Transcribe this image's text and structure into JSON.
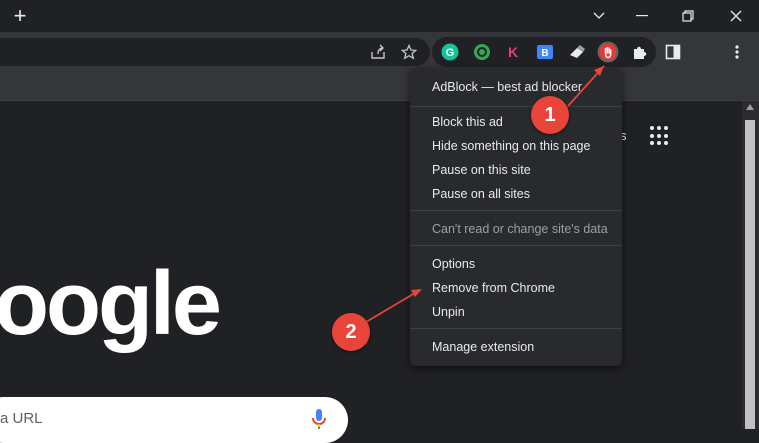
{
  "titlebar": {
    "new_tab_glyph": "+",
    "icons": [
      "chevron-down-icon",
      "restore-icon",
      "close-icon"
    ]
  },
  "toolbar": {
    "icons": [
      "share-icon",
      "star-icon",
      "puzzle-icon",
      "sidepanel-icon",
      "kebab-menu-icon"
    ]
  },
  "extensions": [
    {
      "name": "grammarly-icon",
      "glyph": "G",
      "color": "#15c39a"
    },
    {
      "name": "green-extension-icon",
      "glyph": "",
      "color": "#34a853"
    },
    {
      "name": "k-extension-icon",
      "glyph": "K",
      "color": "#e2436b"
    },
    {
      "name": "blue-extension-icon",
      "glyph": "B",
      "color": "#4285f4"
    },
    {
      "name": "eraser-extension-icon",
      "glyph": "",
      "color": "#e8eaed"
    },
    {
      "name": "adblock-icon",
      "glyph": "",
      "color": "#e53935"
    }
  ],
  "page": {
    "logo_text": "oogle",
    "search_placeholder": "a URL",
    "partial_letter": "s"
  },
  "menu": {
    "title": "AdBlock — best ad blocker",
    "group1": [
      "Block this ad",
      "Hide something on this page",
      "Pause on this site",
      "Pause on all sites"
    ],
    "disabled": "Can't read or change site's data",
    "group2": [
      "Options",
      "Remove from Chrome",
      "Unpin"
    ],
    "manage": "Manage extension"
  },
  "annotations": [
    {
      "label": "1",
      "color": "#e8443a"
    },
    {
      "label": "2",
      "color": "#e8443a"
    }
  ]
}
